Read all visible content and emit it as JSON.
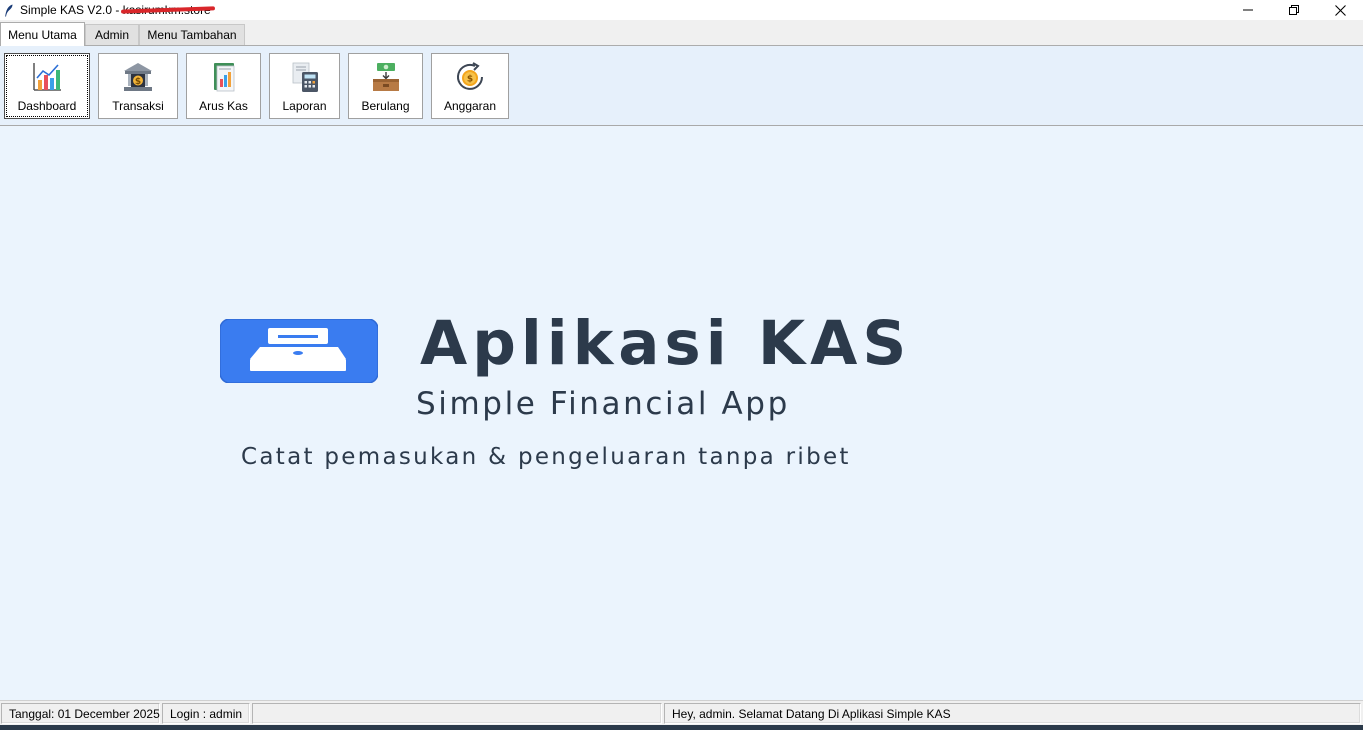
{
  "window": {
    "title_prefix": "Simple KAS V2.0 - ",
    "title_redacted": "kasirumkm.store"
  },
  "tabs": [
    {
      "label": "Menu Utama",
      "active": true
    },
    {
      "label": "Admin",
      "active": false
    },
    {
      "label": "Menu Tambahan",
      "active": false
    }
  ],
  "toolbar": {
    "buttons": [
      {
        "label": "Dashboard",
        "icon": "chart-icon"
      },
      {
        "label": "Transaksi",
        "icon": "bank-icon"
      },
      {
        "label": "Arus Kas",
        "icon": "report-icon"
      },
      {
        "label": "Laporan",
        "icon": "calculator-icon"
      },
      {
        "label": "Berulang",
        "icon": "money-box-icon"
      },
      {
        "label": "Anggaran",
        "icon": "coin-cycle-icon"
      }
    ]
  },
  "hero": {
    "title": "Aplikasi KAS",
    "subtitle": "Simple Financial App",
    "tagline": "Catat pemasukan & pengeluaran tanpa ribet"
  },
  "status": {
    "date": "Tanggal: 01 December 2025",
    "login": "Login : admin",
    "message": "Hey, admin. Selamat Datang Di Aplikasi Simple KAS"
  },
  "colors": {
    "accent": "#3a7cf0",
    "hero_text": "#2c3a4b",
    "toolbar_bg": "#e6f0fb",
    "main_bg": "#ebf4fd"
  }
}
